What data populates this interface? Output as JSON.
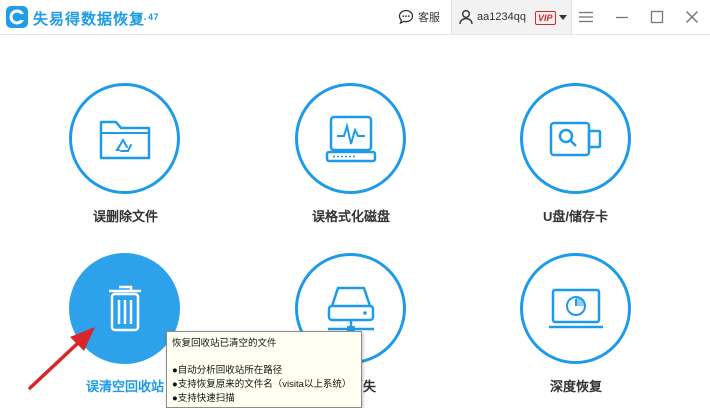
{
  "app": {
    "title": "失易得数据恢复",
    "version": "6.47",
    "support_label": "客服",
    "username": "aa1234qq",
    "vip_badge": "VIP"
  },
  "tiles": [
    {
      "label": "误删除文件",
      "icon": "folder-recycle-icon"
    },
    {
      "label": "误格式化磁盘",
      "icon": "disk-format-icon"
    },
    {
      "label": "U盘/储存卡",
      "icon": "usb-drive-icon"
    },
    {
      "label": "误清空回收站",
      "icon": "trash-icon",
      "selected": true
    },
    {
      "label": "分区消失",
      "icon": "partition-icon"
    },
    {
      "label": "深度恢复",
      "icon": "deep-scan-icon"
    }
  ],
  "tooltip": {
    "title": "恢复回收站已清空的文件",
    "items": [
      "●自动分析回收站所在路径",
      "●支持恢复原来的文件名（visita以上系统）",
      "●支持快速扫描"
    ]
  },
  "colors": {
    "accent": "#1d9be9",
    "arrow": "#d8262b",
    "vip": "#d12a2a"
  }
}
